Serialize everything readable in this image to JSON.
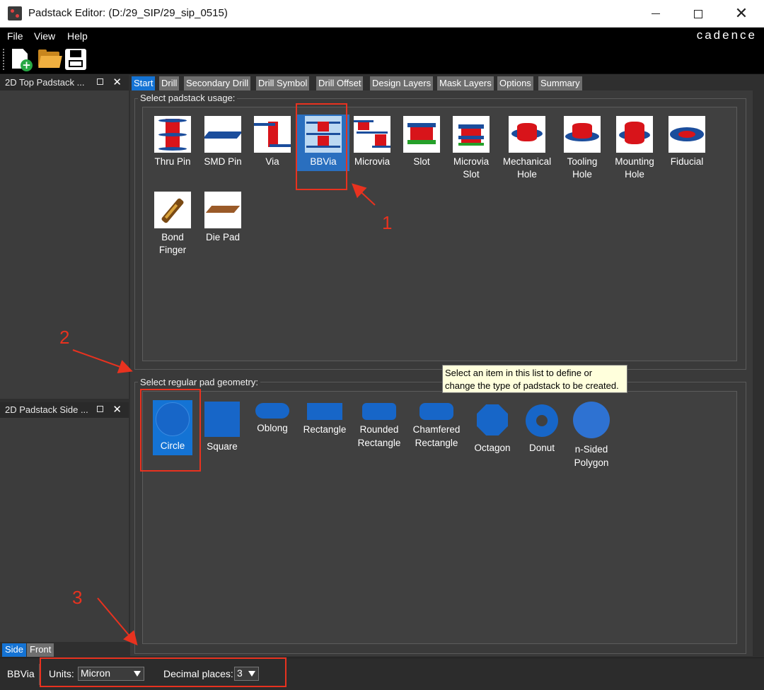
{
  "window": {
    "title": "Padstack Editor:  (D:/29_SIP/29_sip_0515)"
  },
  "menu": {
    "file": "File",
    "view": "View",
    "help": "Help",
    "brand": "cadence"
  },
  "toolbar": {
    "new_icon": "new-file-icon",
    "open_icon": "open-folder-icon",
    "save_icon": "save-disk-icon"
  },
  "docks": {
    "top_title": "2D Top Padstack ...",
    "side_title": "2D Padstack Side ...",
    "tabs": [
      "Side",
      "Front"
    ]
  },
  "tabs": [
    "Start",
    "Drill",
    "Secondary Drill",
    "Drill Symbol",
    "Drill Offset",
    "Design Layers",
    "Mask Layers",
    "Options",
    "Summary"
  ],
  "usage": {
    "label": "Select padstack usage:",
    "items": [
      {
        "line1": "Thru Pin",
        "line2": ""
      },
      {
        "line1": "SMD Pin",
        "line2": ""
      },
      {
        "line1": "Via",
        "line2": ""
      },
      {
        "line1": "BBVia",
        "line2": ""
      },
      {
        "line1": "Microvia",
        "line2": ""
      },
      {
        "line1": "Slot",
        "line2": ""
      },
      {
        "line1": "Microvia",
        "line2": "Slot"
      },
      {
        "line1": "Mechanical",
        "line2": "Hole"
      },
      {
        "line1": "Tooling",
        "line2": "Hole"
      },
      {
        "line1": "Mounting",
        "line2": "Hole"
      },
      {
        "line1": "Fiducial",
        "line2": ""
      },
      {
        "line1": "Bond",
        "line2": "Finger"
      },
      {
        "line1": "Die Pad",
        "line2": ""
      }
    ],
    "selected": "BBVia"
  },
  "geometry": {
    "label": "Select regular pad geometry:",
    "items": [
      {
        "line1": "Circle",
        "line2": ""
      },
      {
        "line1": "Square",
        "line2": ""
      },
      {
        "line1": "Oblong",
        "line2": ""
      },
      {
        "line1": "Rectangle",
        "line2": ""
      },
      {
        "line1": "Rounded",
        "line2": "Rectangle"
      },
      {
        "line1": "Chamfered",
        "line2": "Rectangle"
      },
      {
        "line1": "Octagon",
        "line2": ""
      },
      {
        "line1": "Donut",
        "line2": ""
      },
      {
        "line1": "n-Sided",
        "line2": "Polygon"
      }
    ],
    "selected": "Circle"
  },
  "tooltip": {
    "line1": "Select an item in this list to define or",
    "line2": "change the type of padstack to be created."
  },
  "status": {
    "usage": "BBVia",
    "units_label": "Units:",
    "units_value": "Micron",
    "decimal_label": "Decimal places:",
    "decimal_value": "3"
  },
  "annotations": {
    "one": "1",
    "two": "2",
    "three": "3"
  },
  "colors": {
    "accent": "#1473d4",
    "annotation": "#e8321f",
    "pad_blue": "#1766c8"
  }
}
